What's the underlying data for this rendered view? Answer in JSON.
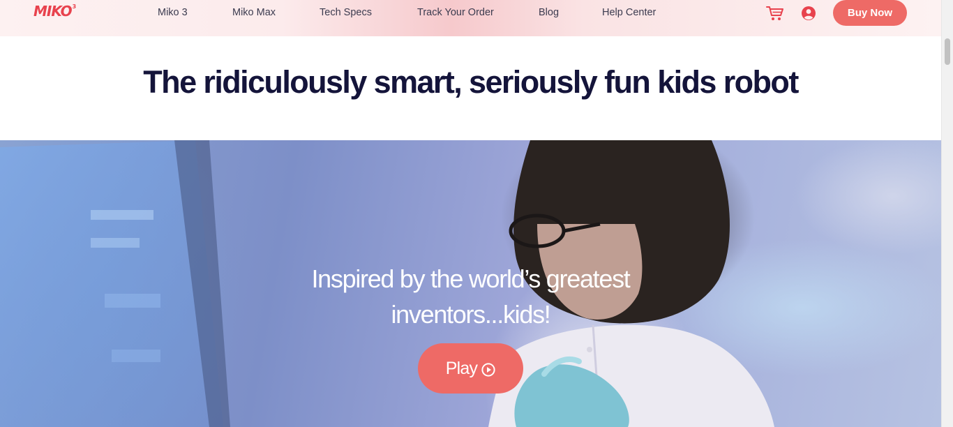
{
  "brand": {
    "logo_text": "MIKO",
    "logo_superscript": "3",
    "accent_color": "#ee6a66",
    "logo_color": "#e8424d",
    "heading_color": "#14143a"
  },
  "nav": {
    "links": [
      {
        "label": "Miko 3"
      },
      {
        "label": "Miko Max"
      },
      {
        "label": "Tech Specs"
      },
      {
        "label": "Track Your Order"
      },
      {
        "label": "Blog"
      },
      {
        "label": "Help Center"
      }
    ],
    "cart_icon": "shopping-cart-icon",
    "user_icon": "user-account-icon",
    "buy_now_label": "Buy Now"
  },
  "headline": {
    "text": "The ridiculously smart, seriously fun kids robot"
  },
  "hero": {
    "line1": "Inspired by the world’s greatest",
    "line2": "inventors...kids!",
    "play_label": "Play",
    "play_icon": "play-circle-icon"
  }
}
